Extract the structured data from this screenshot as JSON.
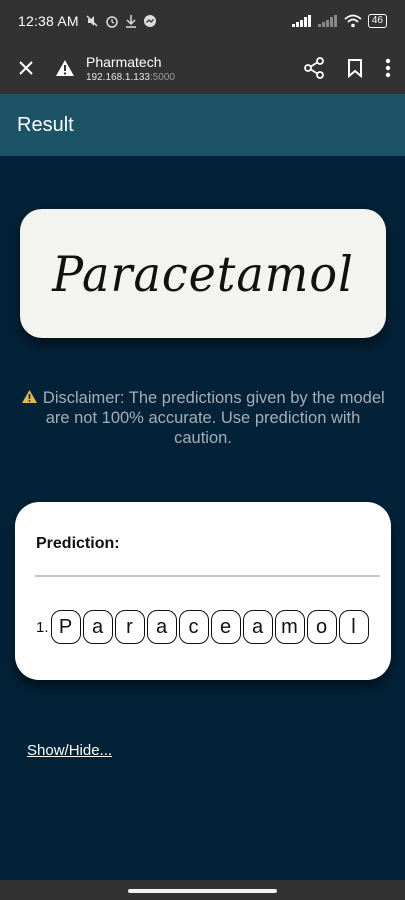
{
  "status_bar": {
    "time": "12:38 AM",
    "left_icons": [
      "mute-icon",
      "alarm-icon",
      "download-icon",
      "messenger-icon"
    ],
    "battery": "46"
  },
  "browser": {
    "site_name": "Pharmatech",
    "url_host": "192.168.1.133",
    "url_port": ":5000"
  },
  "header": {
    "title": "Result"
  },
  "image_card": {
    "handwritten_text": "Paracetamol"
  },
  "disclaimer": {
    "text": "Disclaimer: The predictions given by the model are not 100% accurate. Use prediction with caution."
  },
  "prediction": {
    "title": "Prediction:",
    "index": "1.",
    "letters": [
      "P",
      "a",
      "r",
      "a",
      "c",
      "e",
      "a",
      "m",
      "o",
      "l"
    ]
  },
  "show_hide": {
    "label": "Show/Hide..."
  },
  "colors": {
    "page_bg": "#032238",
    "header_bg": "#1c5366",
    "chrome_bg": "#323232",
    "warning": "#e0b850"
  }
}
